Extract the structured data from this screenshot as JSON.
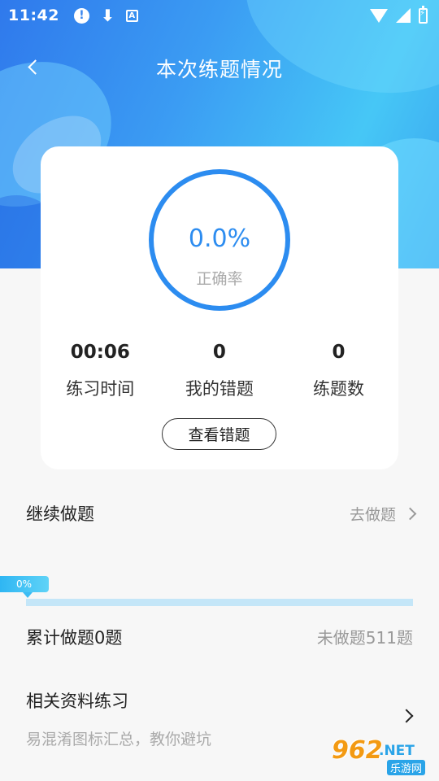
{
  "status_bar": {
    "time": "11:42",
    "alert_glyph": "!",
    "download_glyph": "⬇",
    "a_glyph": "A",
    "icons": [
      "alert-icon",
      "download-icon",
      "a-box-icon",
      "wifi-icon",
      "signal-icon",
      "battery-icon"
    ]
  },
  "header": {
    "title": "本次练题情况",
    "back_icon": "back-chevron-icon"
  },
  "summary": {
    "accuracy_value": "0.0%",
    "accuracy_label": "正确率",
    "stats": [
      {
        "value": "00:06",
        "label": "练习时间"
      },
      {
        "value": "0",
        "label": "我的错题"
      },
      {
        "value": "0",
        "label": "练题数"
      }
    ],
    "review_button_label": "查看错题"
  },
  "continue": {
    "title": "继续做题",
    "link_label": "去做题",
    "progress_label": "0%",
    "progress_fraction": 0.0,
    "done_text": "累计做题0题",
    "undone_text": "未做题511题"
  },
  "related": {
    "title": "相关资料练习",
    "description": "易混淆图标汇总，教你避坑"
  },
  "watermark": {
    "main": "962",
    "net": ".NET",
    "sub": "乐游网"
  },
  "colors": {
    "accent_blue": "#2c8cf0",
    "progress_blue": "#2fb6f3",
    "background": "#f7f7f7"
  }
}
